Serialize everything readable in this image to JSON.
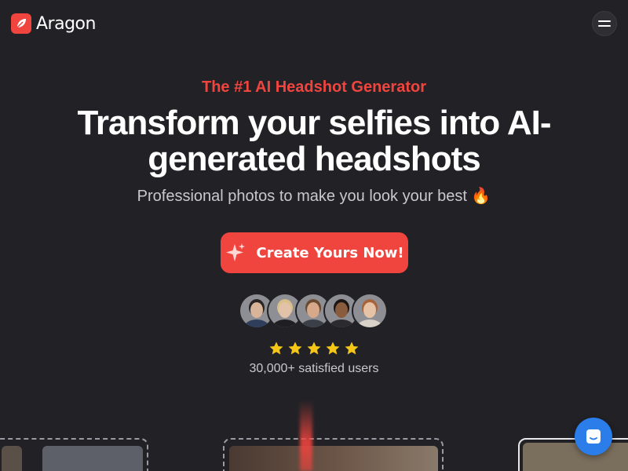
{
  "header": {
    "brand": "Aragon",
    "logo_icon": "leaf-icon",
    "menu_icon": "hamburger-icon"
  },
  "hero": {
    "eyebrow": "The #1 AI Headshot Generator",
    "headline": "Transform your selfies into AI-generated headshots",
    "subline": "Professional photos to make you look your best 🔥"
  },
  "cta": {
    "label": "Create Yours Now!",
    "icon": "sparkle-icon"
  },
  "social_proof": {
    "avatars": [
      {
        "name": "avatar-man-suit",
        "skin": "#d8b59a",
        "hair": "#2a2522",
        "shirt": "#2f3e5a"
      },
      {
        "name": "avatar-woman-blonde",
        "skin": "#e2c2a8",
        "hair": "#d9c08a",
        "shirt": "#1f1f22"
      },
      {
        "name": "avatar-man-beard",
        "skin": "#d6a98a",
        "hair": "#6b4a32",
        "shirt": "#3a3f48"
      },
      {
        "name": "avatar-man-dark",
        "skin": "#8a5c3e",
        "hair": "#1b1513",
        "shirt": "#2a2a2f"
      },
      {
        "name": "avatar-woman-auburn",
        "skin": "#e6c3a6",
        "hair": "#a8623c",
        "shirt": "#d8d2c8"
      }
    ],
    "rating": 5,
    "star_color": "#f5c518",
    "users_text": "30,000+ satisfied users"
  },
  "chat": {
    "icon": "chat-icon"
  },
  "colors": {
    "accent": "#f0453f",
    "background": "#222226",
    "chat": "#2b7de9"
  }
}
